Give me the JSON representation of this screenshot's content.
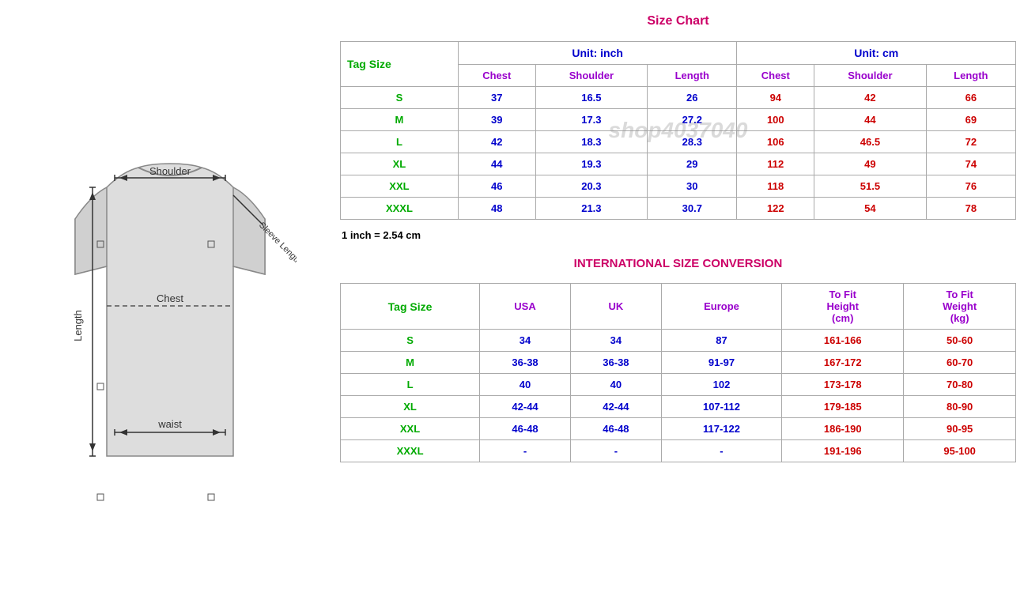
{
  "left": {
    "diagram_labels": {
      "shoulder": "Shoulder",
      "sleeve": "Sleeve Length",
      "chest": "Chest",
      "length": "Length",
      "waist": "waist"
    }
  },
  "size_chart": {
    "title": "Size Chart",
    "unit_inch": "Unit: inch",
    "unit_cm": "Unit: cm",
    "tag_size_label": "Tag Size",
    "inch_cols": [
      "Chest",
      "Shoulder",
      "Length"
    ],
    "cm_cols": [
      "Chest",
      "Shoulder",
      "Length"
    ],
    "rows": [
      {
        "tag": "S",
        "inch_chest": "37",
        "inch_shoulder": "16.5",
        "inch_length": "26",
        "cm_chest": "94",
        "cm_shoulder": "42",
        "cm_length": "66"
      },
      {
        "tag": "M",
        "inch_chest": "39",
        "inch_shoulder": "17.3",
        "inch_length": "27.2",
        "cm_chest": "100",
        "cm_shoulder": "44",
        "cm_length": "69"
      },
      {
        "tag": "L",
        "inch_chest": "42",
        "inch_shoulder": "18.3",
        "inch_length": "28.3",
        "cm_chest": "106",
        "cm_shoulder": "46.5",
        "cm_length": "72"
      },
      {
        "tag": "XL",
        "inch_chest": "44",
        "inch_shoulder": "19.3",
        "inch_length": "29",
        "cm_chest": "112",
        "cm_shoulder": "49",
        "cm_length": "74"
      },
      {
        "tag": "XXL",
        "inch_chest": "46",
        "inch_shoulder": "20.3",
        "inch_length": "30",
        "cm_chest": "118",
        "cm_shoulder": "51.5",
        "cm_length": "76"
      },
      {
        "tag": "XXXL",
        "inch_chest": "48",
        "inch_shoulder": "21.3",
        "inch_length": "30.7",
        "cm_chest": "122",
        "cm_shoulder": "54",
        "cm_length": "78"
      }
    ],
    "note": "1 inch = 2.54 cm"
  },
  "intl_conversion": {
    "title": "INTERNATIONAL SIZE CONVERSION",
    "tag_size_label": "Tag Size",
    "cols": [
      "USA",
      "UK",
      "Europe",
      "To Fit\nHeight\n(cm)",
      "To Fit\nWeight\n(kg)"
    ],
    "col_to_fit_height": "To Fit Height (cm)",
    "col_to_fit_weight": "To Fit Weight (kg)",
    "rows": [
      {
        "tag": "S",
        "usa": "34",
        "uk": "34",
        "europe": "87",
        "height": "161-166",
        "weight": "50-60"
      },
      {
        "tag": "M",
        "usa": "36-38",
        "uk": "36-38",
        "europe": "91-97",
        "height": "167-172",
        "weight": "60-70"
      },
      {
        "tag": "L",
        "usa": "40",
        "uk": "40",
        "europe": "102",
        "height": "173-178",
        "weight": "70-80"
      },
      {
        "tag": "XL",
        "usa": "42-44",
        "uk": "42-44",
        "europe": "107-112",
        "height": "179-185",
        "weight": "80-90"
      },
      {
        "tag": "XXL",
        "usa": "46-48",
        "uk": "46-48",
        "europe": "117-122",
        "height": "186-190",
        "weight": "90-95"
      },
      {
        "tag": "XXXL",
        "usa": "-",
        "uk": "-",
        "europe": "-",
        "height": "191-196",
        "weight": "95-100"
      }
    ]
  },
  "watermark": "shop4037040"
}
